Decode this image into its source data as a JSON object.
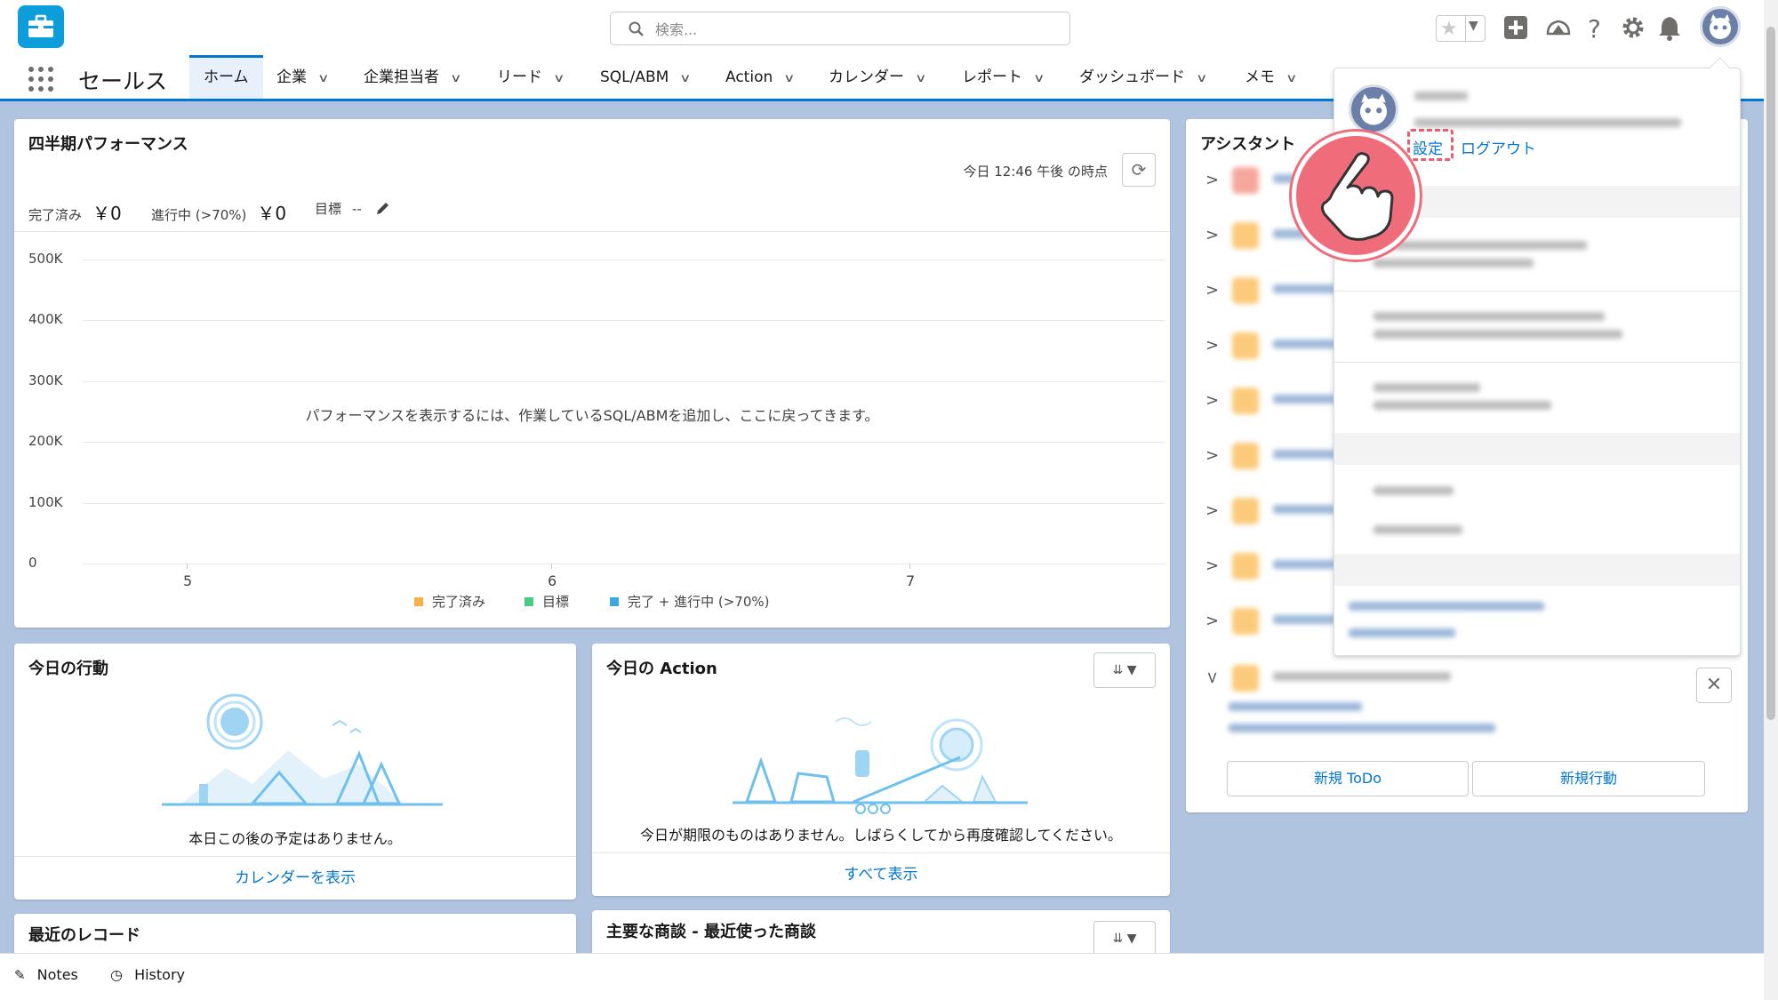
{
  "search": {
    "placeholder": "検索..."
  },
  "app": {
    "name": "セールス"
  },
  "nav": {
    "tabs": [
      {
        "label": "ホーム"
      },
      {
        "label": "企業"
      },
      {
        "label": "企業担当者"
      },
      {
        "label": "リード"
      },
      {
        "label": "SQL/ABM"
      },
      {
        "label": "Action"
      },
      {
        "label": "カレンダー"
      },
      {
        "label": "レポート"
      },
      {
        "label": "ダッシュボード"
      },
      {
        "label": "メモ"
      }
    ]
  },
  "performance": {
    "title": "四半期パフォーマンス",
    "as_of": "今日 12:46 午後 の時点",
    "closed_label": "完了済み",
    "closed_value": "￥0",
    "open_label": "進行中 (>70%)",
    "open_value": "￥0",
    "goal_label": "目標",
    "goal_value": "--",
    "message": "パフォーマンスを表示するには、作業しているSQL/ABMを追加し、ここに戻ってきます。"
  },
  "chart_data": {
    "type": "line",
    "title": "四半期パフォーマンス",
    "x": [
      "5",
      "6",
      "7"
    ],
    "y_ticks": [
      "500K",
      "400K",
      "300K",
      "200K",
      "100K",
      "0"
    ],
    "ylim": [
      0,
      500000
    ],
    "series": [
      {
        "name": "完了済み",
        "values": [],
        "color": "#f4b04a"
      },
      {
        "name": "目標",
        "values": [],
        "color": "#4bca81"
      },
      {
        "name": "完了 + 進行中 (>70%)",
        "values": [],
        "color": "#3ea7e0"
      }
    ],
    "grid": true,
    "legend": "bottom"
  },
  "events": {
    "title": "今日の行動",
    "empty": "本日この後の予定はありません。",
    "link": "カレンダーを表示"
  },
  "actions": {
    "title": "今日の Action",
    "empty": "今日が期限のものはありません。しばらくしてから再度確認してください。",
    "link": "すべて表示"
  },
  "recent": {
    "title": "最近のレコード"
  },
  "deals": {
    "title": "主要な商談 - 最近使った商談"
  },
  "assistant": {
    "title": "アシスタント",
    "new_todo": "新規 ToDo",
    "new_activity": "新規行動"
  },
  "profile": {
    "settings": "設定",
    "logout": "ログアウト"
  },
  "utility": {
    "notes": "Notes",
    "history": "History"
  },
  "colors": {
    "brand": "#0176d3",
    "highlight": "#ef6d7b"
  }
}
